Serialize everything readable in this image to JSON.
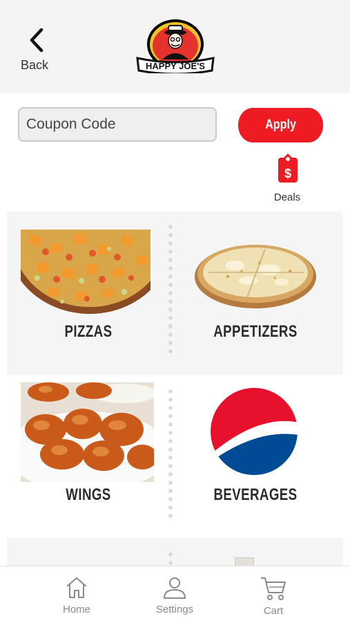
{
  "header": {
    "back_label": "Back",
    "logo_text": "HAPPY JOE'S"
  },
  "coupon": {
    "placeholder": "Coupon Code",
    "apply_label": "Apply"
  },
  "deals": {
    "label": "Deals",
    "icon": "price-tag-icon"
  },
  "categories": [
    {
      "label": "PIZZAS",
      "image": "pizza-image"
    },
    {
      "label": "APPETIZERS",
      "image": "cheese-bread-image"
    },
    {
      "label": "WINGS",
      "image": "wings-image"
    },
    {
      "label": "BEVERAGES",
      "image": "pepsi-logo"
    }
  ],
  "tabbar": {
    "items": [
      {
        "label": "Home",
        "icon": "home-icon"
      },
      {
        "label": "Settings",
        "icon": "person-icon"
      },
      {
        "label": "Cart",
        "icon": "cart-icon"
      }
    ]
  },
  "colors": {
    "brand_red": "#ed1c24",
    "header_bg": "#f4f4f4",
    "tile_bg": "#f5f5f5"
  }
}
